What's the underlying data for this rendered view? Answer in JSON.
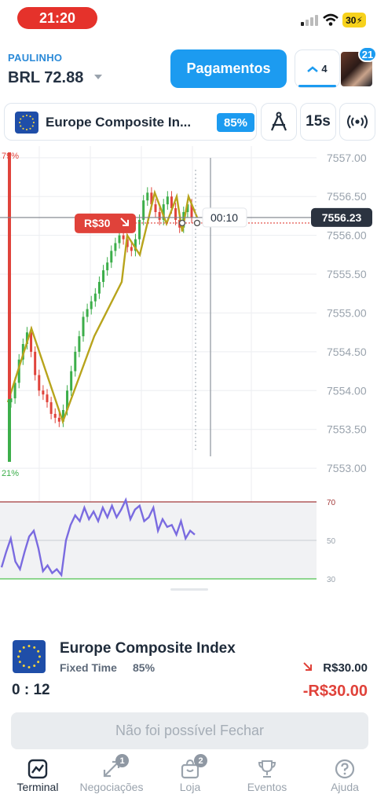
{
  "status_bar": {
    "time": "21:20",
    "battery": "30"
  },
  "header": {
    "user_name": "PAULINHO",
    "balance": "BRL 72.88",
    "payments_label": "Pagamentos",
    "open_trades_count": "4",
    "notifications_count": "21"
  },
  "asset": {
    "name": "Europe Composite In...",
    "payout": "85%"
  },
  "toolbar": {
    "timeframe_label": "15s"
  },
  "chart": {
    "sentiment_high": "79%",
    "sentiment_low": "21%",
    "sentiment_up_fraction": 0.79,
    "price_ticks": [
      "7557.00",
      "7556.50",
      "7556.00",
      "7555.50",
      "7555.00",
      "7554.50",
      "7554.00",
      "7553.50",
      "7553.00"
    ],
    "current_price": "7556.23",
    "countdown": "00:10",
    "trade_badge": "R$30",
    "rsi_ticks": [
      "70",
      "50",
      "30"
    ],
    "colors": {
      "up": "#3cae4a",
      "down": "#e0433b",
      "rsi": "#7a6be0",
      "trend": "#b8a41c"
    }
  },
  "chart_data": {
    "type": "candlestick",
    "ylim": [
      7552.9,
      7557.15
    ],
    "zigzag": [
      7553.85,
      7554.8,
      7553.6,
      7554.7,
      7555.4,
      7556.0,
      7555.75,
      7556.55,
      7556.15,
      7556.5,
      7556.05,
      7556.5,
      7556.23
    ],
    "candles": [
      7553.9,
      7554.1,
      7554.4,
      7554.6,
      7554.75,
      7554.5,
      7554.2,
      7554.0,
      7553.95,
      7553.85,
      7553.7,
      7553.65,
      7553.6,
      7553.75,
      7554.0,
      7554.25,
      7554.5,
      7554.7,
      7554.95,
      7555.05,
      7555.15,
      7555.25,
      7555.4,
      7555.55,
      7555.65,
      7555.8,
      7555.9,
      7556.0,
      7555.95,
      7555.85,
      7555.8,
      7555.95,
      7556.2,
      7556.45,
      7556.55,
      7556.4,
      7556.3,
      7556.2,
      7556.4,
      7556.5,
      7556.35,
      7556.2,
      7556.1,
      7556.3,
      7556.4,
      7556.23
    ],
    "rsi": {
      "ylim": [
        30,
        70
      ],
      "values": [
        36,
        44,
        51,
        39,
        35,
        44,
        52,
        55,
        46,
        34,
        37,
        33,
        35,
        32,
        50,
        58,
        63,
        60,
        67,
        61,
        65,
        60,
        67,
        62,
        68,
        62,
        66,
        71,
        61,
        66,
        68,
        60,
        62,
        67,
        55,
        61,
        57,
        58,
        53,
        60,
        51,
        55,
        53
      ]
    }
  },
  "deal": {
    "asset_name": "Europe Composite Index",
    "mode": "Fixed Time",
    "payout": "85%",
    "timer": "0 : 12",
    "stake": "R$30.00",
    "profit": "-R$30.00",
    "close_label": "Não foi possível Fechar"
  },
  "tabs": [
    {
      "label": "Terminal",
      "badge": ""
    },
    {
      "label": "Negociações",
      "badge": "1"
    },
    {
      "label": "Loja",
      "badge": "2"
    },
    {
      "label": "Eventos",
      "badge": ""
    },
    {
      "label": "Ajuda",
      "badge": ""
    }
  ]
}
